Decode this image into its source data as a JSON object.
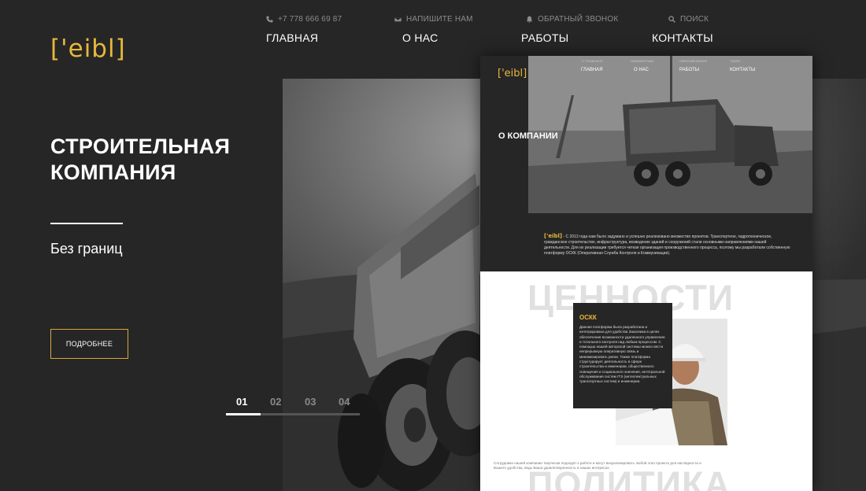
{
  "logo": "['eibl]",
  "topbar": [
    {
      "icon": "phone-icon",
      "label": "+7 778 666 69 87"
    },
    {
      "icon": "mail-icon",
      "label": "НАПИШИТЕ НАМ"
    },
    {
      "icon": "bell-icon",
      "label": "ОБРАТНЫЙ ЗВОНОК"
    },
    {
      "icon": "search-icon",
      "label": "ПОИСК"
    }
  ],
  "nav": [
    "ГЛАВНАЯ",
    "О НАС",
    "РАБОТЫ",
    "КОНТАКТЫ"
  ],
  "hero": {
    "title": "СТРОИТЕЛЬНАЯ КОМПАНИЯ",
    "subtitle": "Без границ",
    "button": "ПОДРОБНЕЕ"
  },
  "pager": {
    "pages": [
      "01",
      "02",
      "03",
      "04"
    ],
    "active": 0
  },
  "mockup": {
    "logo": "['eibl]",
    "topbar": [
      "+7 778 666 69 87",
      "НАПИШИТЕ НАМ",
      "ОБРАТНЫЙ ЗВОНОК",
      "ПОИСК"
    ],
    "nav": [
      "ГЛАВНАЯ",
      "О НАС",
      "РАБОТЫ",
      "КОНТАКТЫ"
    ],
    "about_title": "О КОМПАНИИ",
    "about_brand": "['eibl]",
    "about_text": " - С 2013 года нам было задумано и успешно реализовано множество проектов. Транспортное, гидротехническое, гражданское строительство, инфраструктура, возведение зданий и сооружений стали основными направлениями нашей деятельности. Для их реализации требуется четкая организация производственного процесса, поэтому мы разработали собственную платформу ОСКК (Оперативная Служба Контроля и Коммуникации).",
    "values_heading": "ЦЕННОСТИ",
    "card_title": "ОСКК",
    "card_text": "Данная платформа была разработана и интегрирована для удобства Заказчика в целях обеспечения возможности удаленного управления и тотального контроля над любым процессом. С помощью нашей авторской системы можно вести непрерывную оперативную связь и минимизировать риски. Также платформа структурирует деятельность в сфере строительства и инженерии, общественного освещения и социального значения, интегральной обслуживания систем ITS (интеллектуальных транспортных систем) и инженерии.",
    "footer_text": "Сотрудники нашей компании творчески подходят к работе и могут визуализировать любой этап проекта для наглядности и Вашего удобства, ведь Ваша удовлетворенность в наших интересах.",
    "politika_heading": "ПОЛИТИКА"
  },
  "colors": {
    "background": "#262626",
    "accent": "#e8b83a"
  }
}
